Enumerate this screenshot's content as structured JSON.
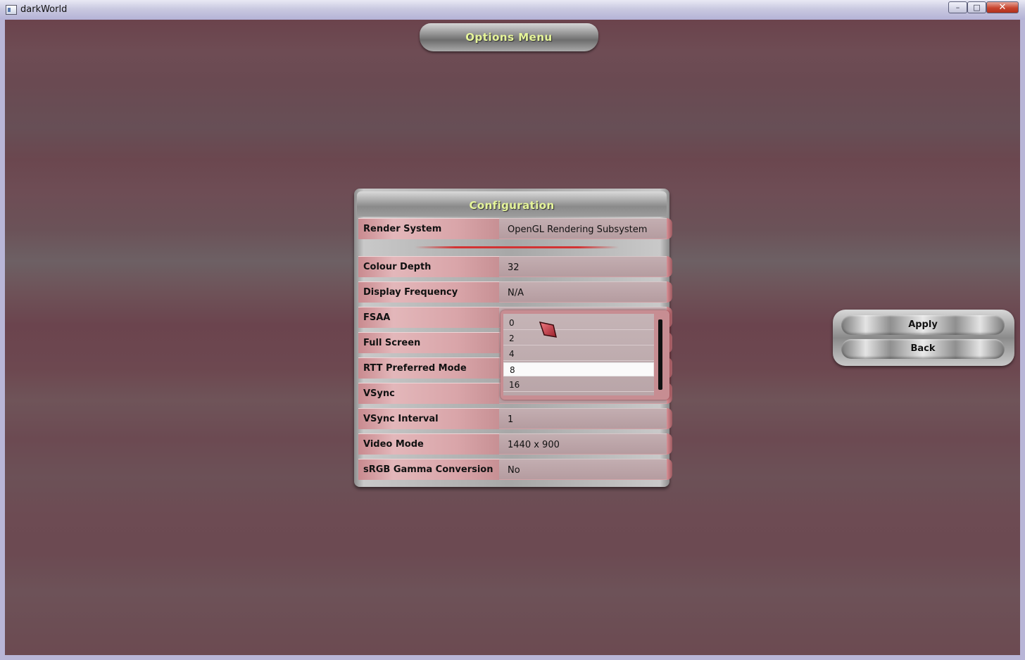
{
  "window": {
    "title": "darkWorld",
    "minimize_glyph": "–",
    "maximize_glyph": "□",
    "close_glyph": "✕"
  },
  "header": {
    "title": "Options Menu"
  },
  "config": {
    "title": "Configuration",
    "rows": [
      {
        "label": "Render System",
        "value": "OpenGL Rendering Subsystem"
      },
      {
        "label": "Colour Depth",
        "value": "32"
      },
      {
        "label": "Display Frequency",
        "value": "N/A"
      },
      {
        "label": "FSAA",
        "value": ""
      },
      {
        "label": "Full Screen",
        "value": ""
      },
      {
        "label": "RTT Preferred Mode",
        "value": ""
      },
      {
        "label": "VSync",
        "value": ""
      },
      {
        "label": "VSync Interval",
        "value": "1"
      },
      {
        "label": "Video Mode",
        "value": "1440 x 900"
      },
      {
        "label": "sRGB Gamma Conversion",
        "value": "No"
      }
    ]
  },
  "fsaa_dropdown": {
    "options": [
      "0",
      "2",
      "4",
      "8",
      "16"
    ],
    "selected": "8"
  },
  "buttons": {
    "apply": "Apply",
    "back": "Back"
  },
  "colors": {
    "accent_text": "#e6f59a",
    "background": "#6b4a52",
    "row_label": "#e3b7ba",
    "separator": "#d23333"
  }
}
